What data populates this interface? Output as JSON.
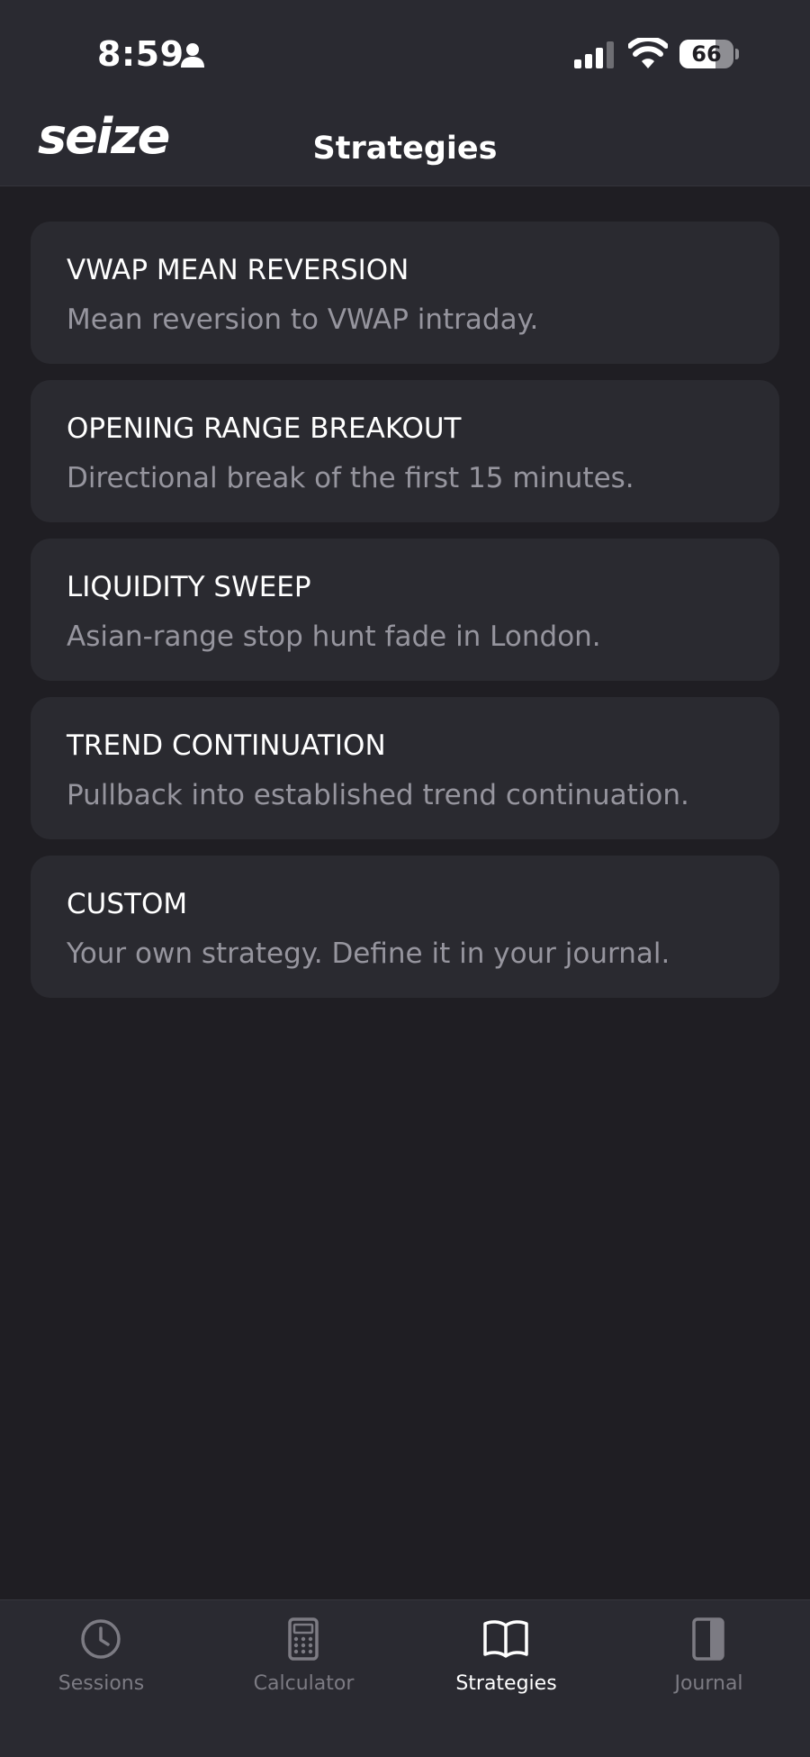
{
  "status_bar": {
    "time": "8:59",
    "battery_level": "66",
    "battery_percent": 66,
    "icons": [
      "person-icon",
      "cellular-signal-icon",
      "wifi-icon",
      "battery-icon"
    ]
  },
  "header": {
    "logo": "seize",
    "title": "Strategies"
  },
  "strategies": [
    {
      "title": "VWAP MEAN REVERSION",
      "description": "Mean reversion to VWAP intraday."
    },
    {
      "title": "OPENING RANGE BREAKOUT",
      "description": "Directional break of the first 15 minutes."
    },
    {
      "title": "LIQUIDITY SWEEP",
      "description": "Asian-range stop hunt fade in London."
    },
    {
      "title": "TREND CONTINUATION",
      "description": "Pullback into established trend continuation."
    },
    {
      "title": "CUSTOM",
      "description": "Your own strategy. Define it in your journal."
    }
  ],
  "tabbar": {
    "tabs": [
      {
        "label": "Sessions",
        "icon": "clock-icon",
        "active": false
      },
      {
        "label": "Calculator",
        "icon": "calculator-icon",
        "active": false
      },
      {
        "label": "Strategies",
        "icon": "book-icon",
        "active": true
      },
      {
        "label": "Journal",
        "icon": "journal-icon",
        "active": false
      }
    ]
  },
  "colors": {
    "background": "#1f1e23",
    "bar_background": "#2a2a31",
    "card_background": "#2a2a30",
    "primary_text": "#ffffff",
    "secondary_text": "#96959e",
    "inactive_tab": "#7c7b83"
  }
}
